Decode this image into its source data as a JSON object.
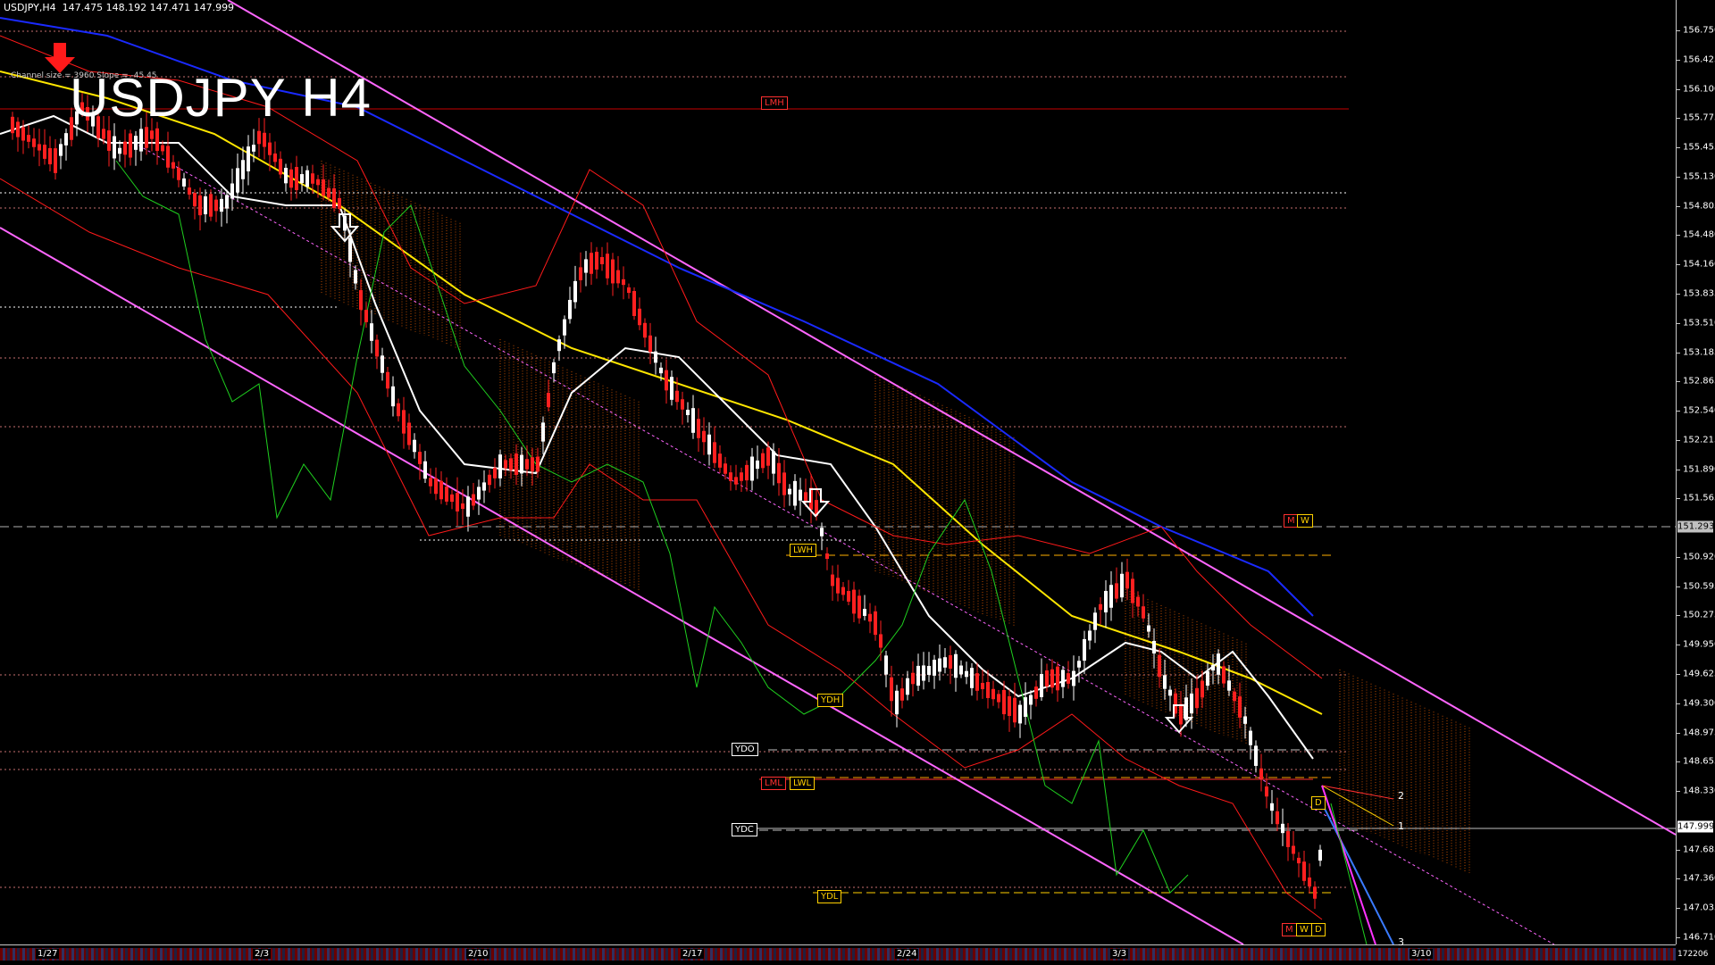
{
  "window": {
    "header": "USDJPY,H4  147.475 148.192 147.471 147.999",
    "big_title": "USDJPY H4",
    "channel_info": "Channel size = 3960 Slope = -45.45"
  },
  "price_axis": {
    "labels": [
      "156.750",
      "156.425",
      "156.100",
      "155.775",
      "155.455",
      "155.130",
      "154.805",
      "154.480",
      "154.160",
      "153.835",
      "153.510",
      "153.185",
      "152.865",
      "152.540",
      "152.215",
      "151.890",
      "151.565",
      "151.293",
      "150.920",
      "150.595",
      "150.275",
      "149.950",
      "149.625",
      "149.300",
      "148.975",
      "148.655",
      "148.330",
      "147.999",
      "147.685",
      "147.360",
      "147.035",
      "146.710"
    ],
    "current_price": "147.999",
    "marked_price": "151.293",
    "corner": "172206"
  },
  "time_axis": {
    "dates": [
      "1/27",
      "2/3",
      "2/10",
      "2/17",
      "2/24",
      "3/3",
      "3/10"
    ]
  },
  "level_tags": {
    "lmh": "LMH",
    "m": "M",
    "w": "W",
    "lwh": "LWH",
    "ydh": "YDH",
    "ydo": "YDO",
    "lml": "LML",
    "lwl": "LWL",
    "ydc": "YDC",
    "ydl": "YDL",
    "d": "D"
  },
  "targets": {
    "t1": "1",
    "t2": "2",
    "t3": "3"
  },
  "colors": {
    "background": "#000000",
    "bull_candle": "#ffffff",
    "bear_candle": "#ff2020",
    "channel": "#ff66ff",
    "ma_blue": "#1a2aff",
    "ma_yellow": "#ffe600",
    "ma_white": "#ffffff",
    "bands_red": "#ff1a1a",
    "cloud": "#b84a00",
    "green_line": "#1fd01f"
  },
  "icons": [
    "down-arrow-icon",
    "signal-arrow-icon"
  ]
}
